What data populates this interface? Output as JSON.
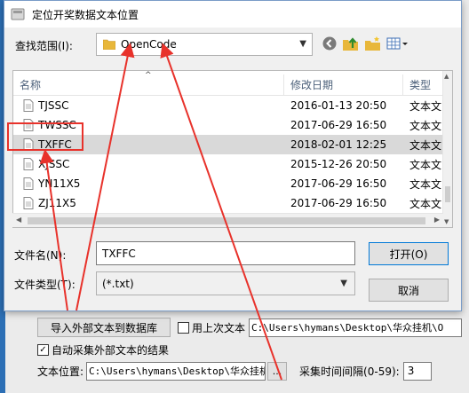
{
  "dialog": {
    "title": "定位开奖数据文本位置",
    "look_in_label": "查找范围(I):",
    "look_in_value": "OpenCode",
    "nav_icons": [
      "back-icon",
      "up-folder-icon",
      "new-folder-icon",
      "view-menu-icon"
    ]
  },
  "file_list": {
    "columns": {
      "name": "名称",
      "date": "修改日期",
      "type": "类型"
    },
    "rows": [
      {
        "name": "TJSSC",
        "date": "2016-01-13 20:50",
        "type": "文本文"
      },
      {
        "name": "TWSSC",
        "date": "2017-06-29 16:50",
        "type": "文本文"
      },
      {
        "name": "TXFFC",
        "date": "2018-02-01 12:25",
        "type": "文本文"
      },
      {
        "name": "XJSSC",
        "date": "2015-12-26 20:50",
        "type": "文本文"
      },
      {
        "name": "YN11X5",
        "date": "2017-06-29 16:50",
        "type": "文本文"
      },
      {
        "name": "ZJ11X5",
        "date": "2017-06-29 16:50",
        "type": "文本文"
      }
    ],
    "selected_index": 2
  },
  "filename": {
    "label": "文件名(N):",
    "value": "TXFFC"
  },
  "filetype": {
    "label": "文件类型(T):",
    "value": "(*.txt)"
  },
  "buttons": {
    "open": "打开(O)",
    "cancel": "取消"
  },
  "background_app": {
    "import_button": "导入外部文本到数据库",
    "use_last_label": "用上次文本",
    "use_last_checked": false,
    "path_top": "C:\\Users\\hymans\\Desktop\\华众挂机\\O",
    "auto_collect_label": "自动采集外部文本的结果",
    "auto_collect_checked": true,
    "text_location_label": "文本位置:",
    "path_bottom": "C:\\Users\\hymans\\Desktop\\华众挂机\\",
    "browse_label": "...",
    "interval_label": "采集时间间隔(0-59):",
    "interval_value": "3"
  },
  "colors": {
    "annotation": "#e8322b",
    "selection": "#d9d9d9",
    "folder": "#e8b73a"
  }
}
